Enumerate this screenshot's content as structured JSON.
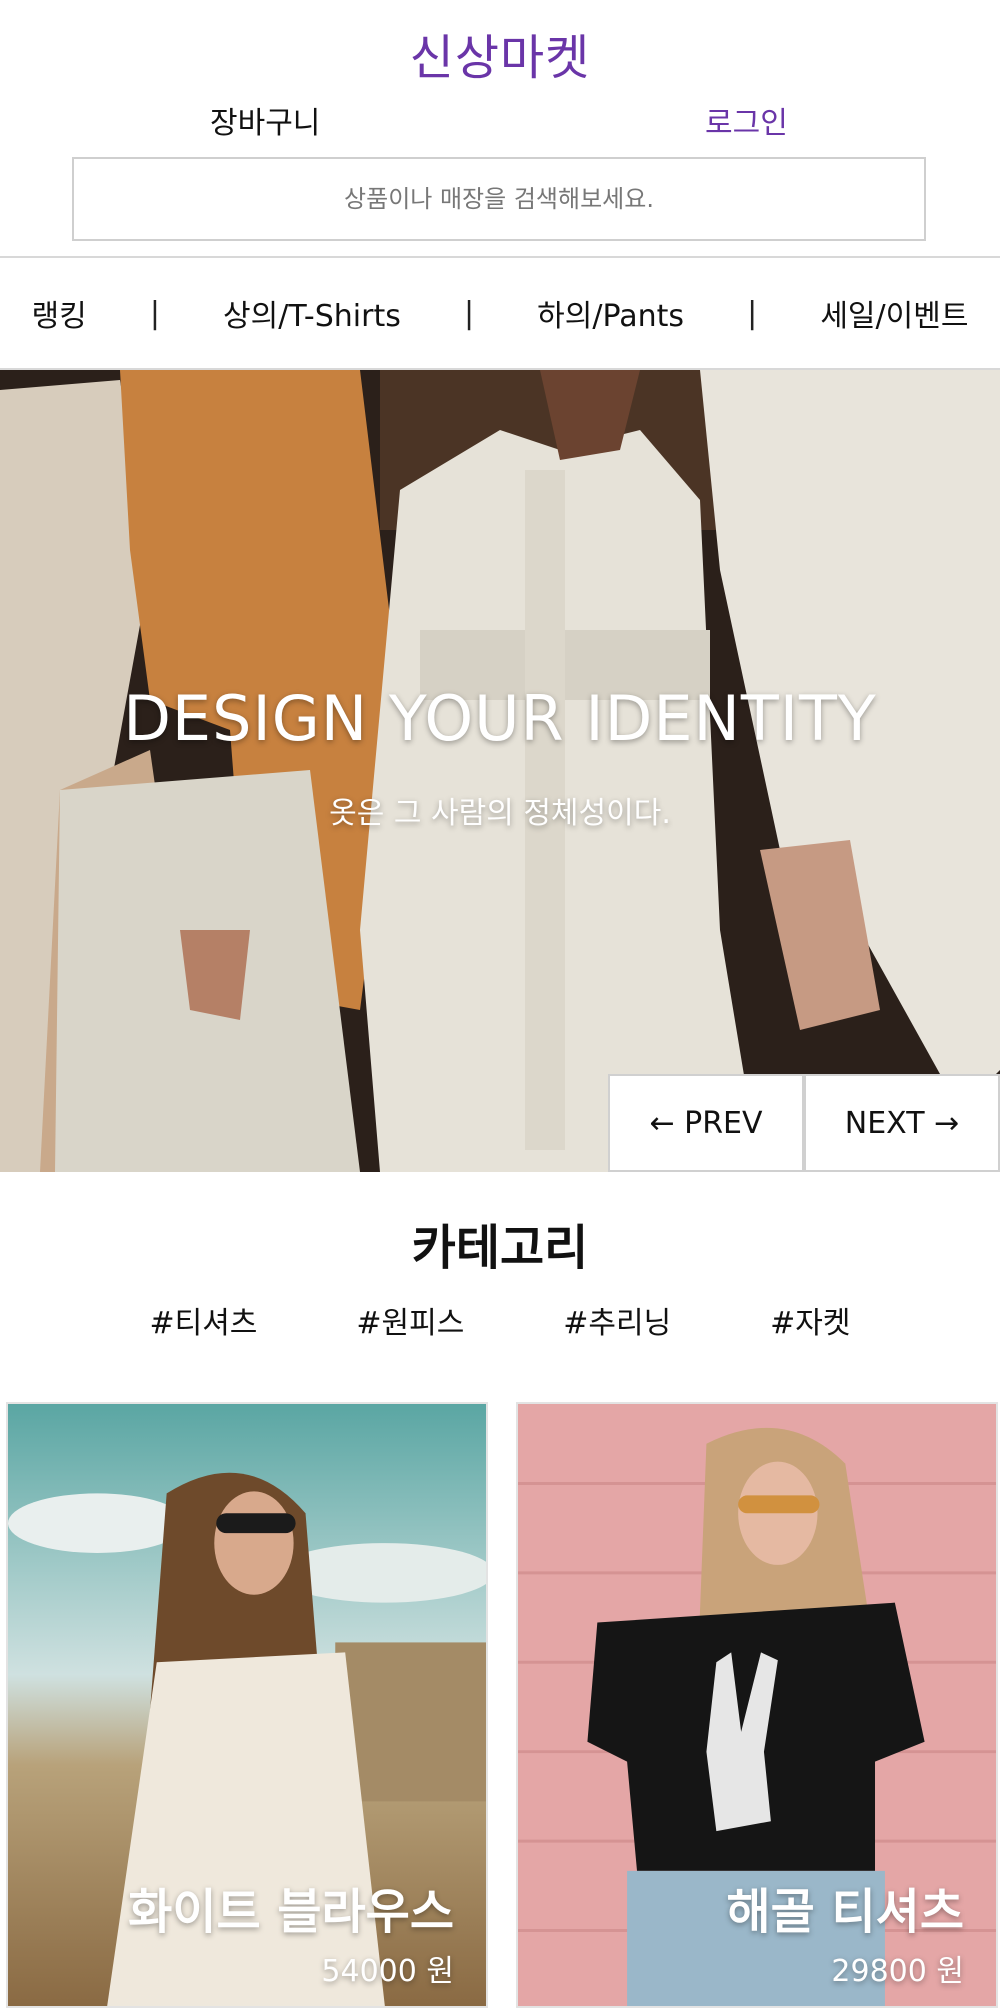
{
  "brand": "신상마켓",
  "topbar": {
    "cart": "장바구니",
    "login": "로그인"
  },
  "search": {
    "placeholder": "상품이나 매장을 검색해보세요."
  },
  "nav": {
    "items": [
      "랭킹",
      "상의/T-Shirts",
      "하의/Pants",
      "세일/이벤트"
    ],
    "separator": "|"
  },
  "hero": {
    "title": "DESIGN YOUR IDENTITY",
    "subtitle": "옷은 그 사람의 정체성이다.",
    "prev": "← PREV",
    "next": "NEXT →"
  },
  "category": {
    "title": "카테고리",
    "tags": [
      "#티셔츠",
      "#원피스",
      "#추리닝",
      "#자켓"
    ]
  },
  "products": [
    {
      "name": "화이트 블라우스",
      "price": "54000 원"
    },
    {
      "name": "해골 티셔츠",
      "price": "29800 원"
    }
  ],
  "colors": {
    "brand": "#6a35a8",
    "divider": "#d8d8d8"
  }
}
